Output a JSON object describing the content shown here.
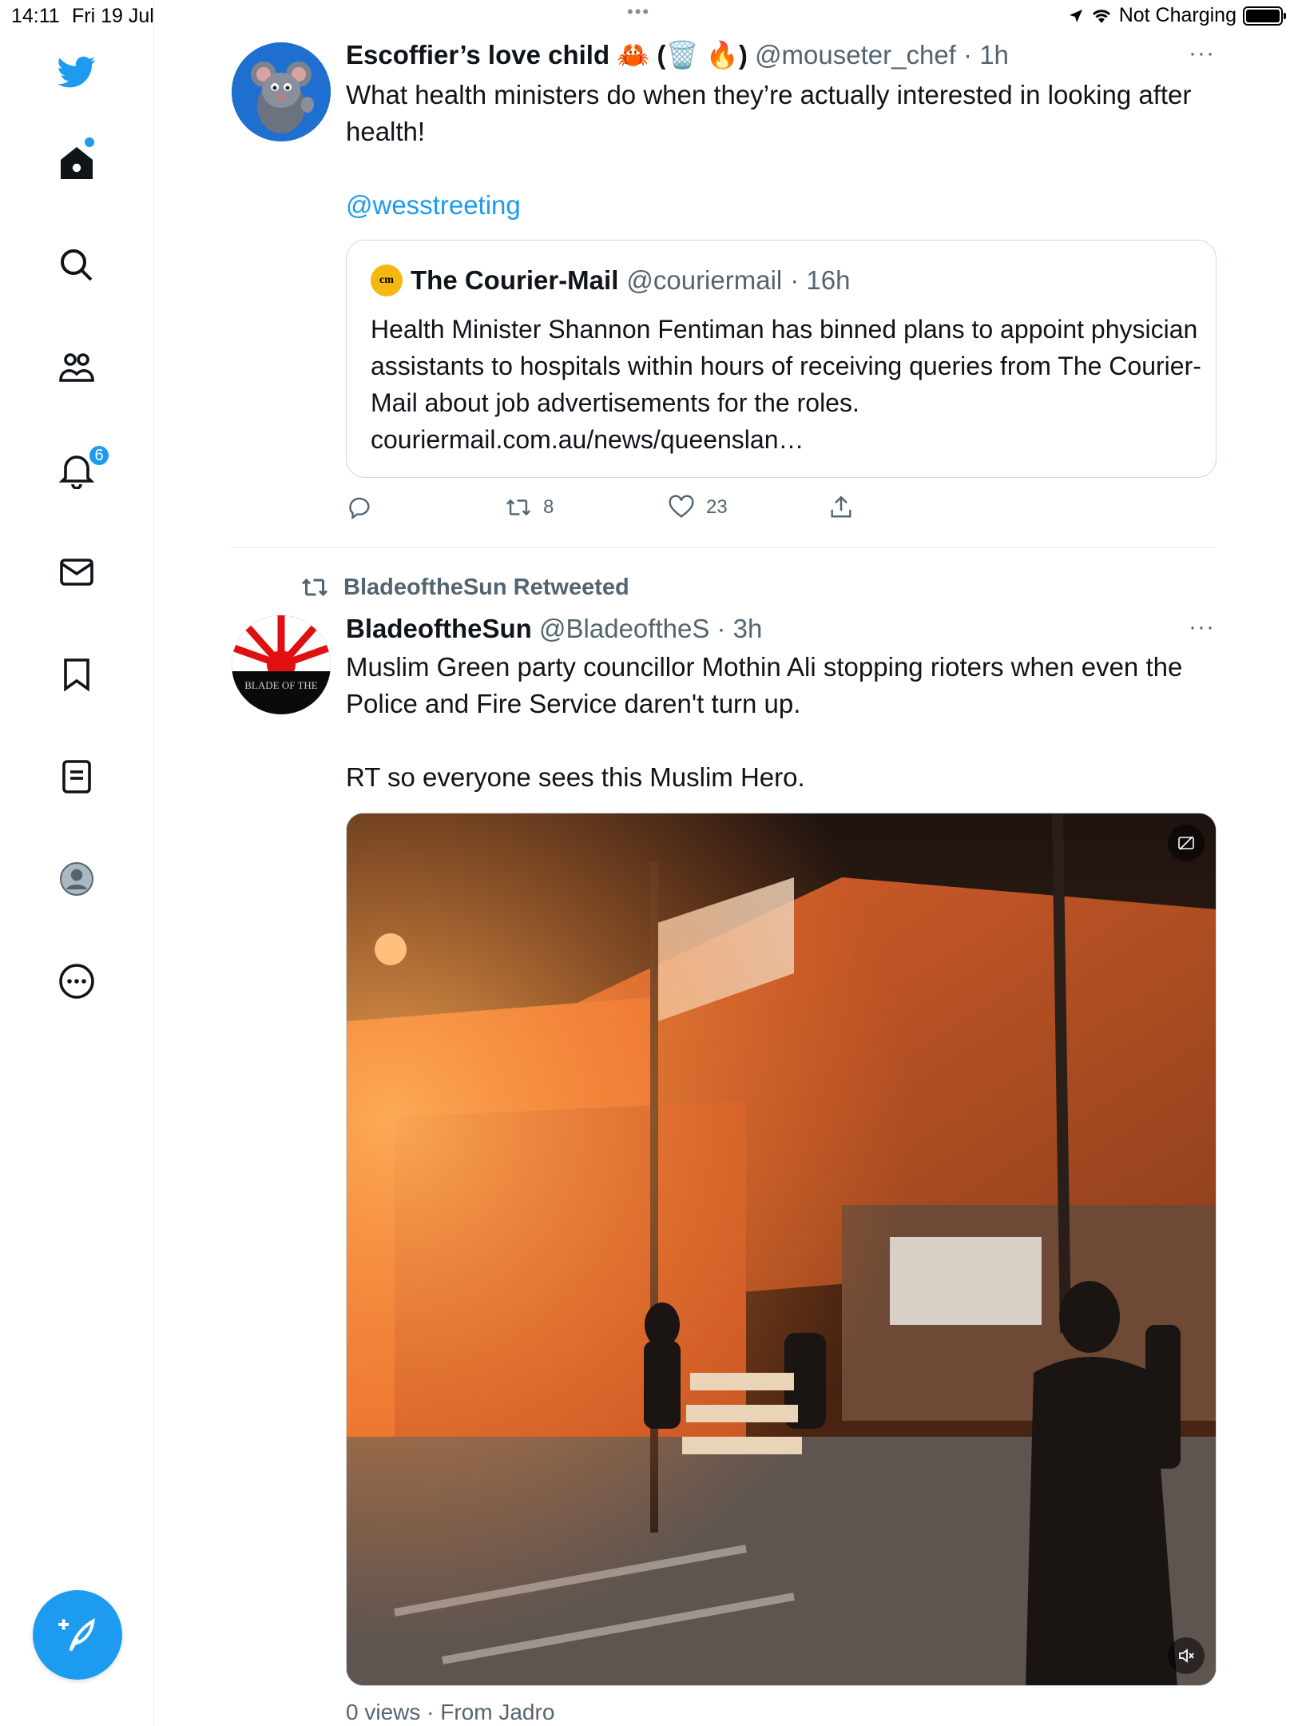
{
  "status_bar": {
    "time": "14:11",
    "date": "Fri 19 Jul",
    "charging": "Not Charging"
  },
  "sidebar": {
    "items": [
      {
        "icon": "twitter-bird-icon"
      },
      {
        "icon": "home-icon"
      },
      {
        "icon": "search-icon"
      },
      {
        "icon": "communities-icon"
      },
      {
        "icon": "notifications-icon",
        "badge": "6"
      },
      {
        "icon": "messages-icon"
      },
      {
        "icon": "bookmarks-icon"
      },
      {
        "icon": "lists-icon"
      },
      {
        "icon": "profile-icon"
      },
      {
        "icon": "more-icon"
      }
    ],
    "compose_icon": "compose-tweet-icon",
    "accent": "#1d9bf0"
  },
  "tweet1": {
    "name": "Escoffier’s love child",
    "name_emoji": "🦀 (🗑️ 🔥)",
    "handle": "@mouseter_chef",
    "time": "· 1h",
    "more": "···",
    "text": "What health ministers do when they’re actually interested in looking after health!",
    "mention": "@wesstreeting",
    "quote": {
      "logo": "cm",
      "name": "The Courier-Mail",
      "handle": "@couriermail",
      "time": "· 16h",
      "text": "Health Minister Shannon Fentiman has binned plans to appoint physician assistants to hospitals within hours of receiving queries from The Courier-Mail about job advertisements for the roles. couriermail.com.au/news/queenslan…"
    },
    "retweets": "8",
    "likes": "23"
  },
  "tweet2": {
    "retweeted_by": "BladeoftheSun Retweeted",
    "name": "BladeoftheSun",
    "handle": "@BladeoftheS",
    "time": "· 3h",
    "more": "···",
    "text_line1": "Muslim Green party councillor Mothin Ali stopping rioters when even the Police and Fire Service daren't turn up.",
    "text_line2": "RT so everyone sees this Muslim Hero.",
    "avatar_text": "BLADE OF THE",
    "views": "0 views · From Jadro"
  }
}
